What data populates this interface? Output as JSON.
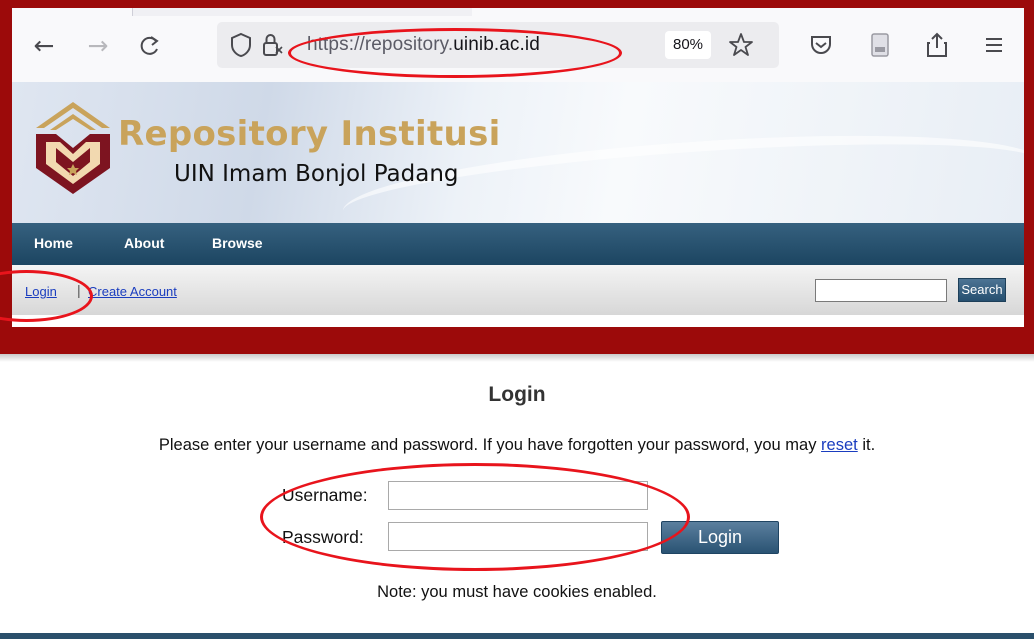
{
  "browser": {
    "url_scheme_prefix": "https://repository.",
    "url_host": "uinib.ac.id",
    "zoom_level": "80%",
    "icons": [
      "back-arrow-icon",
      "forward-arrow-icon",
      "reload-icon",
      "shield-icon",
      "lock-icon",
      "star-icon",
      "pocket-icon",
      "reader-icon",
      "share-icon",
      "menu-icon"
    ]
  },
  "site": {
    "title": "Repository Institusi",
    "subtitle": "UIN Imam Bonjol Padang",
    "colors": {
      "frame": "#9c0a0a",
      "menubar": "#1c4561",
      "title": "#c9a35b",
      "annotation": "#e8141c"
    }
  },
  "menu": {
    "items": [
      {
        "label": "Home"
      },
      {
        "label": "About"
      },
      {
        "label": "Browse"
      }
    ]
  },
  "account_bar": {
    "login_label": "Login",
    "separator": "|",
    "create_label": "Create Account",
    "search_value": "",
    "search_button_label": "Search"
  },
  "login_page": {
    "heading": "Login",
    "instructions_before": "Please enter your username and password. If you have forgotten your password, you may ",
    "reset_label": "reset",
    "instructions_after": " it.",
    "username_label": "Username:",
    "username_value": "",
    "password_label": "Password:",
    "password_value": "",
    "submit_label": "Login",
    "note": "Note: you must have cookies enabled."
  }
}
